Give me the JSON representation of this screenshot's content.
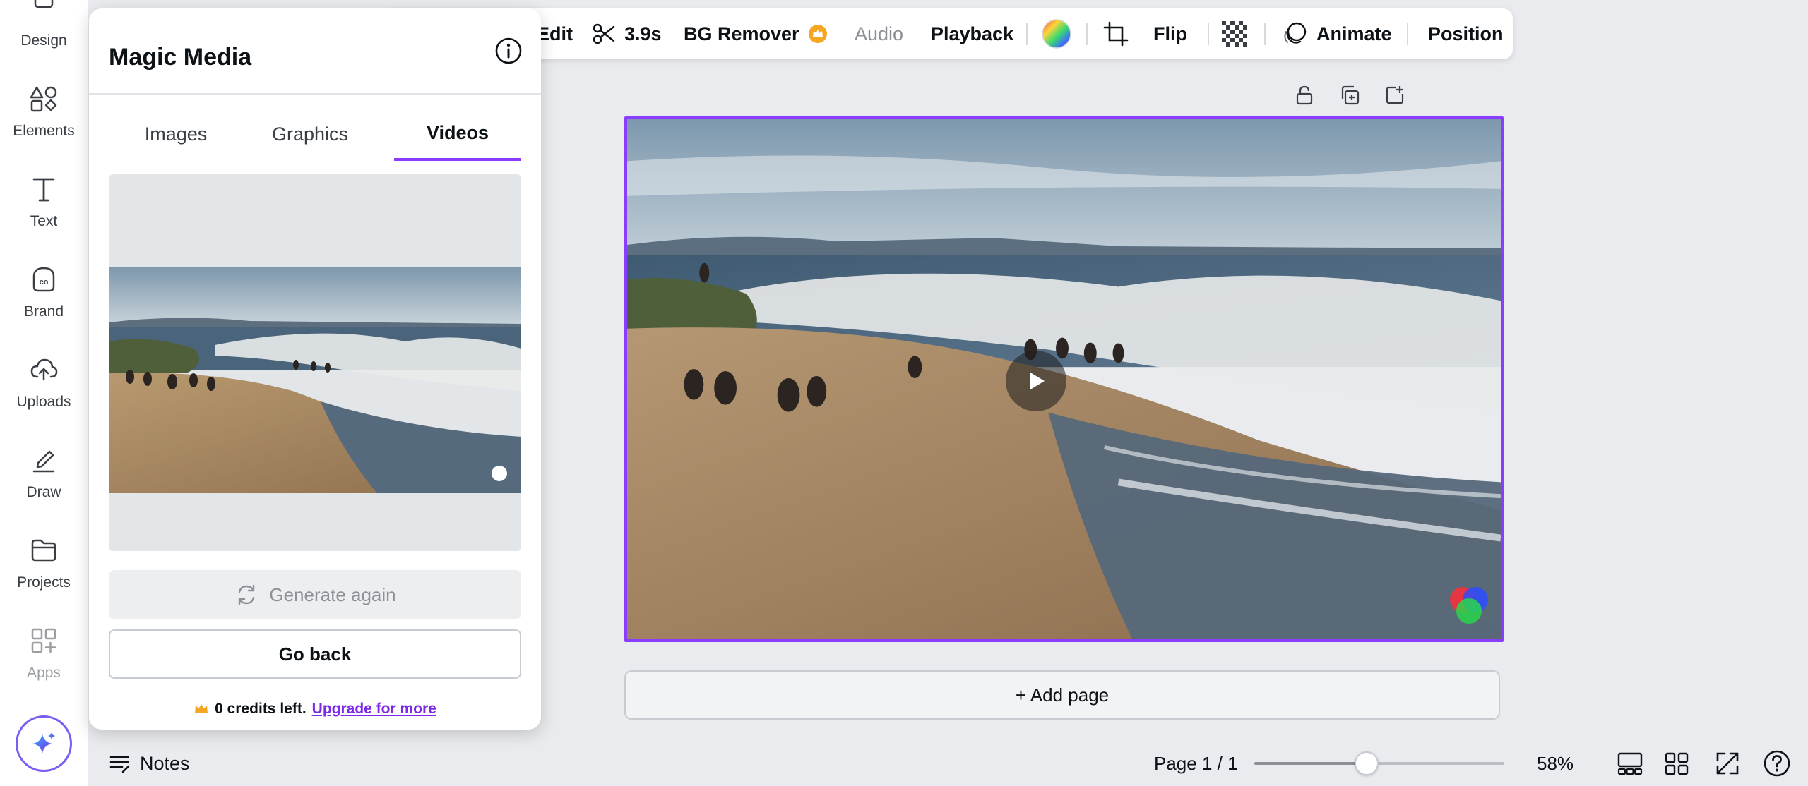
{
  "rail": {
    "items": [
      {
        "label": "Design",
        "icon": "design-icon"
      },
      {
        "label": "Elements",
        "icon": "elements-icon"
      },
      {
        "label": "Text",
        "icon": "text-icon"
      },
      {
        "label": "Brand",
        "icon": "brand-icon"
      },
      {
        "label": "Uploads",
        "icon": "uploads-icon"
      },
      {
        "label": "Draw",
        "icon": "draw-icon"
      },
      {
        "label": "Projects",
        "icon": "projects-icon"
      },
      {
        "label": "Apps",
        "icon": "apps-icon"
      }
    ],
    "magic_icon": "sparkle-icon"
  },
  "panel": {
    "title": "Magic Media",
    "tabs": [
      {
        "label": "Images",
        "active": false
      },
      {
        "label": "Graphics",
        "active": false
      },
      {
        "label": "Videos",
        "active": true
      }
    ],
    "generate_label": "Generate again",
    "back_label": "Go back",
    "credits_text": "0 credits left.",
    "upgrade_link": "Upgrade for more"
  },
  "toolbar": {
    "edit": "Edit",
    "duration": "3.9s",
    "bg_remover": "BG Remover",
    "audio": "Audio",
    "playback": "Playback",
    "flip": "Flip",
    "animate": "Animate",
    "position": "Position"
  },
  "canvas": {
    "add_page": "+ Add page"
  },
  "bottom": {
    "notes": "Notes",
    "page": "Page 1 / 1",
    "zoom_fraction": 0.45,
    "zoom": "58%"
  },
  "colors": {
    "accent": "#8b3dff",
    "link": "#7d2ae8",
    "premium": "#f5a623"
  }
}
